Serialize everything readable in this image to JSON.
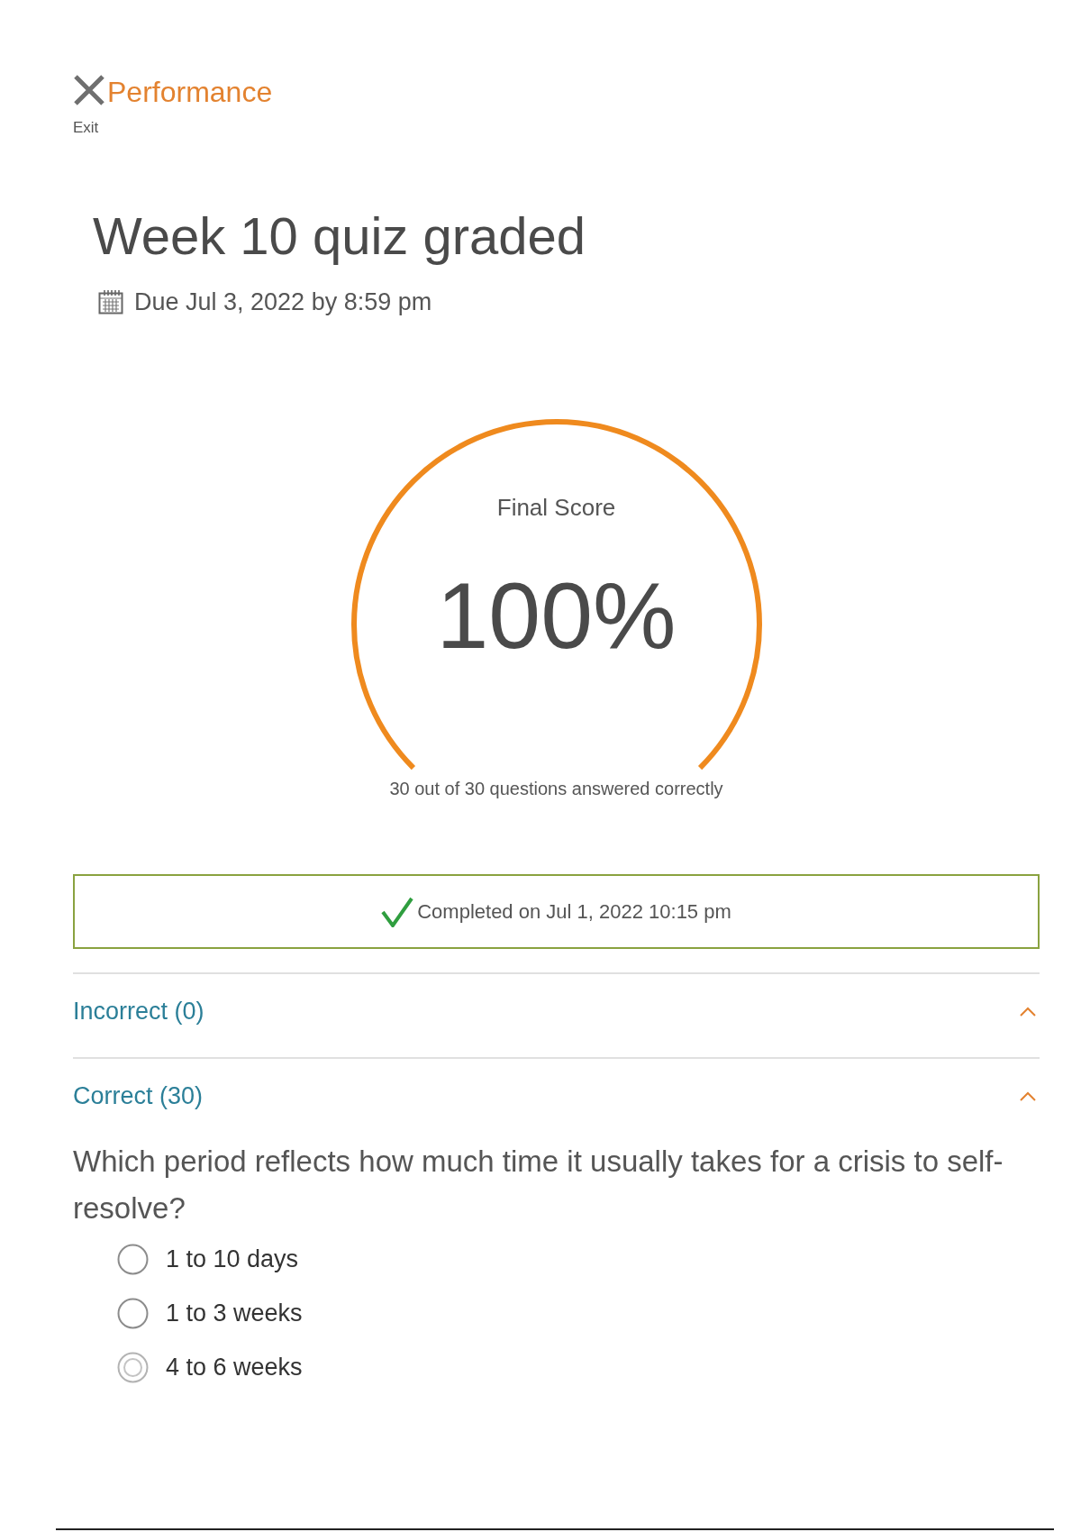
{
  "header": {
    "title": "Performance",
    "exit_label": "Exit"
  },
  "assignment": {
    "title": "Week 10 quiz graded",
    "due": "Due Jul 3, 2022 by 8:59 pm"
  },
  "score": {
    "label": "Final Score",
    "value": "100%",
    "level": 1,
    "summary": "30 out of 30 questions answered correctly"
  },
  "completion": {
    "text": "Completed on Jul 1, 2022 10:15 pm"
  },
  "sections": [
    {
      "title": "Incorrect (0)",
      "expanded": true
    },
    {
      "title": "Correct (30)",
      "expanded": true,
      "questions": [
        {
          "text": "Which period reflects how much time it usually takes for a crisis to self-resolve?",
          "options": [
            {
              "label": "1 to 10 days",
              "selected": false
            },
            {
              "label": "1 to 3 weeks",
              "selected": false
            },
            {
              "label": "4 to 6 weeks",
              "selected": true
            }
          ]
        }
      ]
    }
  ]
}
